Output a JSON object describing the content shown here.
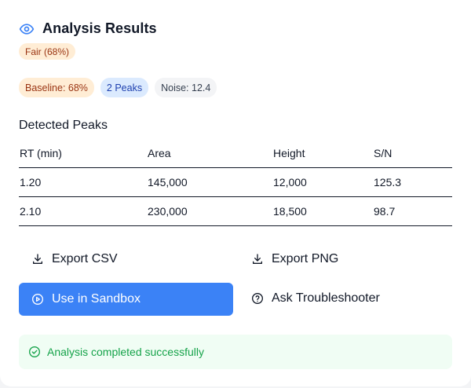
{
  "header": {
    "title": "Analysis Results",
    "icon": "eye-icon",
    "accent": "#3b82f6"
  },
  "quality_badge": {
    "label": "Fair (68%)"
  },
  "pills": [
    {
      "label": "Baseline: 68%",
      "color": "#9a3412"
    },
    {
      "label": "2 Peaks",
      "color": "#1e40af"
    },
    {
      "label": "Noise: 12.4",
      "color": "#374151"
    }
  ],
  "peaks": {
    "title": "Detected Peaks",
    "columns": [
      "RT (min)",
      "Area",
      "Height",
      "S/N"
    ],
    "rows": [
      [
        "1.20",
        "145,000",
        "12,000",
        "125.3"
      ],
      [
        "2.10",
        "230,000",
        "18,500",
        "98.7"
      ]
    ]
  },
  "actions": {
    "export_csv": "Export CSV",
    "export_png": "Export PNG",
    "sandbox": "Use in Sandbox",
    "troubleshooter": "Ask Troubleshooter"
  },
  "status": {
    "message": "Analysis completed successfully",
    "color": "#16a34a"
  }
}
